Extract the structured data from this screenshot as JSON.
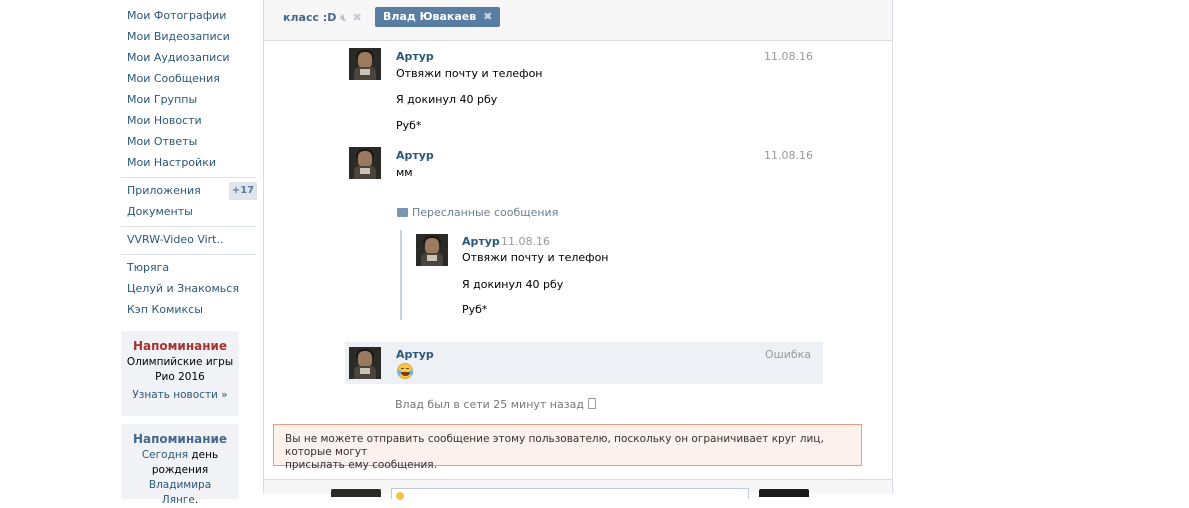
{
  "sidebar": {
    "items": [
      {
        "label": "Мои Фотографии"
      },
      {
        "label": "Мои Видеозаписи"
      },
      {
        "label": "Мои Аудиозаписи"
      },
      {
        "label": "Мои Сообщения"
      },
      {
        "label": "Мои Группы"
      },
      {
        "label": "Мои Новости"
      },
      {
        "label": "Мои Ответы"
      },
      {
        "label": "Мои Настройки"
      }
    ],
    "apps": [
      {
        "label": "Приложения",
        "badge": "+17"
      },
      {
        "label": "Документы"
      }
    ],
    "pinned": [
      {
        "label": "VVRW-Video Virt.."
      }
    ],
    "groups": [
      {
        "label": "Тюряга"
      },
      {
        "label": "Целуй и Знакомься"
      },
      {
        "label": "Кэп Комиксы"
      }
    ],
    "reminder1": {
      "title": "Напоминание",
      "text1": "Олимпийские игры",
      "text2": "Рио 2016",
      "link": "Узнать новости »"
    },
    "reminder2": {
      "title": "Напоминание",
      "text1": "Сегодня",
      "text_day": "день",
      "text2": "рождения",
      "name1": "Владимира",
      "name2": "Лянге",
      "dot": "."
    }
  },
  "tabs": [
    {
      "label": "класс :D",
      "icon": "speaker-mute-icon"
    },
    {
      "label": "Влад Ювакаев",
      "active": true
    }
  ],
  "messages": [
    {
      "author": "Артур",
      "date": "11.08.16",
      "lines": [
        "Отвяжи почту и телефон",
        "Я докинул 40 рбу",
        "Руб*"
      ]
    },
    {
      "author": "Артур",
      "date": "11.08.16",
      "lines": [
        "мм"
      ]
    }
  ],
  "forwarded": {
    "header": "Пересланные сообщения",
    "author": "Артур",
    "date": "11.08.16",
    "lines": [
      "Отвяжи почту и телефон",
      "Я докинул 40 рбу",
      "Руб*"
    ]
  },
  "failed_message": {
    "author": "Артур",
    "status": "Ошибка",
    "emoji": "face-with-tears-of-joy"
  },
  "status_line": "Влад был в сети 25 минут назад",
  "warning": {
    "line1": "Вы не можете отправить сообщение этому пользователю, поскольку он ограничивает круг лиц, которые могут",
    "line2": "присылать ему сообщения."
  },
  "colors": {
    "link": "#2b587a",
    "active_tab": "#597da3",
    "warning_bg": "#fdf1ed",
    "warning_border": "#e89c85",
    "reminder_red": "#a83232"
  }
}
